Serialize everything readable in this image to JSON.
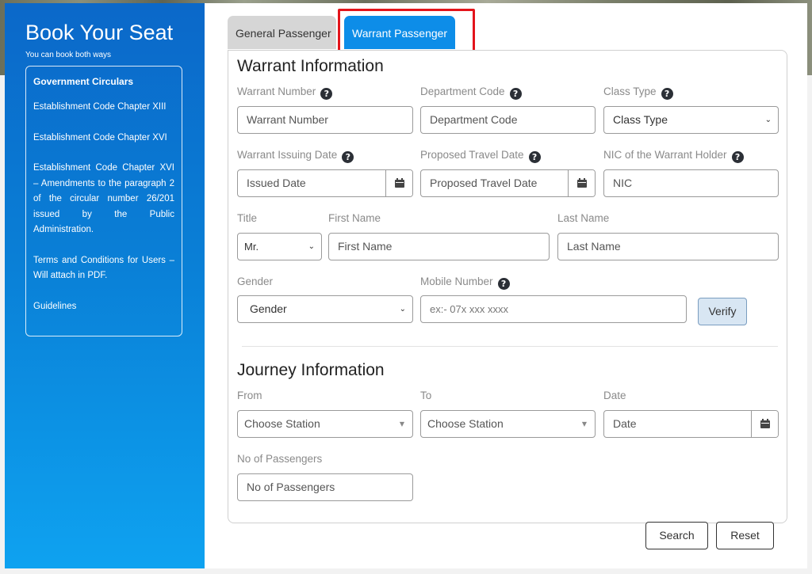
{
  "sidebar": {
    "title": "Book Your Seat",
    "subtitle": "You can book both ways",
    "heading": "Government Circulars",
    "links": [
      "Establishment Code Chapter XIII",
      "Establishment Code Chapter XVI",
      "Establishment Code Chapter XVI – Amendments to the paragraph 2 of the circular number 26/201 issued by the Public Administration.",
      "Terms and Conditions for Users – Will attach in PDF.",
      "Guidelines"
    ]
  },
  "tabs": {
    "general": "General Passenger",
    "warrant": "Warrant Passenger"
  },
  "warrant": {
    "title": "Warrant Information",
    "warrant_number": {
      "label": "Warrant Number",
      "placeholder": "Warrant Number"
    },
    "department_code": {
      "label": "Department Code",
      "placeholder": "Department Code"
    },
    "class_type": {
      "label": "Class Type",
      "value": "Class Type"
    },
    "issuing_date": {
      "label": "Warrant Issuing Date",
      "placeholder": "Issued Date"
    },
    "travel_date": {
      "label": "Proposed Travel Date",
      "placeholder": "Proposed Travel Date"
    },
    "nic": {
      "label": "NIC of the Warrant Holder",
      "placeholder": "NIC"
    },
    "title_field": {
      "label": "Title",
      "value": "Mr."
    },
    "first_name": {
      "label": "First Name",
      "placeholder": "First Name"
    },
    "last_name": {
      "label": "Last Name",
      "placeholder": "Last Name"
    },
    "gender": {
      "label": "Gender",
      "value": "Gender"
    },
    "mobile": {
      "label": "Mobile Number",
      "placeholder": "ex:- 07x xxx xxxx"
    },
    "verify": "Verify"
  },
  "journey": {
    "title": "Journey Information",
    "from": {
      "label": "From",
      "value": "Choose Station"
    },
    "to": {
      "label": "To",
      "value": "Choose Station"
    },
    "date": {
      "label": "Date",
      "placeholder": "Date"
    },
    "passengers": {
      "label": "No of Passengers",
      "placeholder": "No of Passengers"
    }
  },
  "actions": {
    "search": "Search",
    "reset": "Reset"
  },
  "colors": {
    "accent": "#0d8de8",
    "highlight": "#e3141b"
  },
  "icons": [
    "question-circle-icon",
    "calendar-icon",
    "chevron-down-icon",
    "caret-down-icon"
  ]
}
